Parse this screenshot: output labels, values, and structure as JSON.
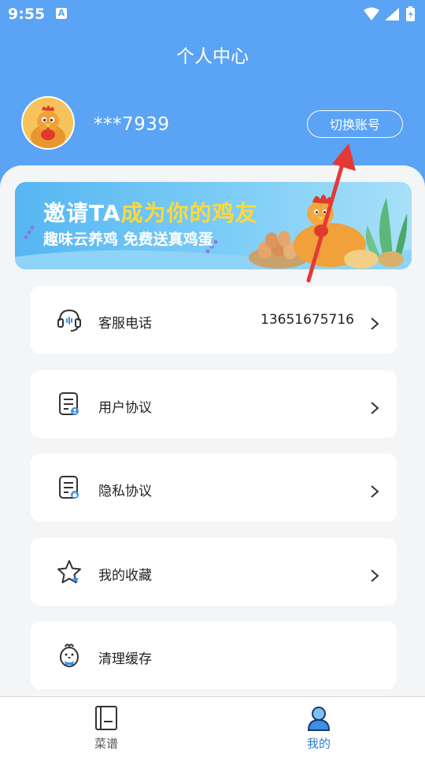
{
  "status_bar": {
    "time": "9:55",
    "notification_letter": "A"
  },
  "header": {
    "title": "个人中心"
  },
  "profile": {
    "phone_masked": "***7939",
    "switch_account_label": "切换账号"
  },
  "banner": {
    "title_part1": "邀请TA",
    "title_part2": "成为你的鸡友",
    "subtitle": "趣味云养鸡 免费送真鸡蛋"
  },
  "menu": {
    "items": [
      {
        "label": "客服电话",
        "value": "13651675716",
        "icon": "headset-icon"
      },
      {
        "label": "用户协议",
        "icon": "document-icon"
      },
      {
        "label": "隐私协议",
        "icon": "privacy-document-icon"
      },
      {
        "label": "我的收藏",
        "icon": "star-icon"
      },
      {
        "label": "清理缓存",
        "icon": "chicken-broom-icon"
      }
    ]
  },
  "tabbar": {
    "tabs": [
      {
        "label": "菜谱",
        "icon": "recipe-book-icon",
        "active": false
      },
      {
        "label": "我的",
        "icon": "profile-icon",
        "active": true
      }
    ]
  },
  "colors": {
    "header_blue": "#5aa3f5",
    "active_tab": "#2e7fd8",
    "inactive_tab": "#555555",
    "annotation_arrow": "#e53935",
    "banner_highlight": "#ffd93a"
  }
}
